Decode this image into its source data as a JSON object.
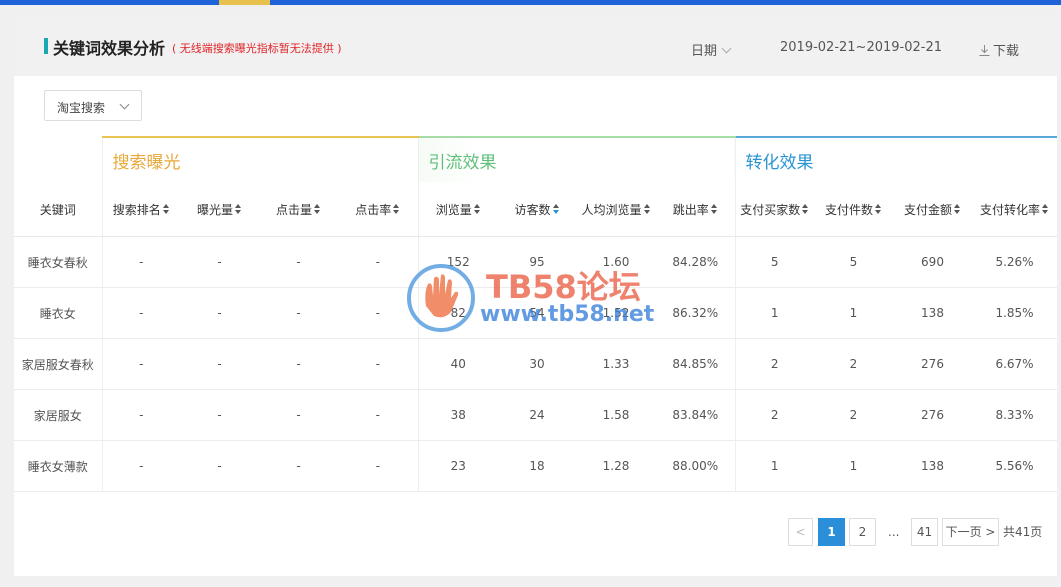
{
  "header": {
    "title": "关键词效果分析",
    "note": "( 无线端搜索曝光指标暂无法提供 )",
    "date_label": "日期",
    "date_range": "2019-02-21~2019-02-21",
    "download_label": "下载"
  },
  "source_select": {
    "value": "淘宝搜索"
  },
  "groups": {
    "search": "搜索曝光",
    "traffic": "引流效果",
    "conversion": "转化效果"
  },
  "columns": [
    "关键词",
    "搜索排名",
    "曝光量",
    "点击量",
    "点击率",
    "浏览量",
    "访客数",
    "人均浏览量",
    "跳出率",
    "支付买家数",
    "支付件数",
    "支付金额",
    "支付转化率"
  ],
  "rows": [
    [
      "睡衣女春秋",
      "-",
      "-",
      "-",
      "-",
      "152",
      "95",
      "1.60",
      "84.28%",
      "5",
      "5",
      "690",
      "5.26%"
    ],
    [
      "睡衣女",
      "-",
      "-",
      "-",
      "-",
      "82",
      "54",
      "1.52",
      "86.32%",
      "1",
      "1",
      "138",
      "1.85%"
    ],
    [
      "家居服女春秋",
      "-",
      "-",
      "-",
      "-",
      "40",
      "30",
      "1.33",
      "84.85%",
      "2",
      "2",
      "276",
      "6.67%"
    ],
    [
      "家居服女",
      "-",
      "-",
      "-",
      "-",
      "38",
      "24",
      "1.58",
      "83.84%",
      "2",
      "2",
      "276",
      "8.33%"
    ],
    [
      "睡衣女薄款",
      "-",
      "-",
      "-",
      "-",
      "23",
      "18",
      "1.28",
      "88.00%",
      "1",
      "1",
      "138",
      "5.56%"
    ]
  ],
  "pagination": {
    "prev": "<",
    "pages": [
      "1",
      "2"
    ],
    "ellipsis": "...",
    "last": "41",
    "next": "下一页 >",
    "total": "共41页"
  },
  "watermark": {
    "title": "TB58论坛",
    "url": "www.tb58.net"
  },
  "colors": {
    "accent": "#2a8fd8",
    "search_group": "#e8a93a",
    "traffic_group": "#5fbf7a",
    "conversion_group": "#2b94d3",
    "note_red": "#e0262b"
  }
}
